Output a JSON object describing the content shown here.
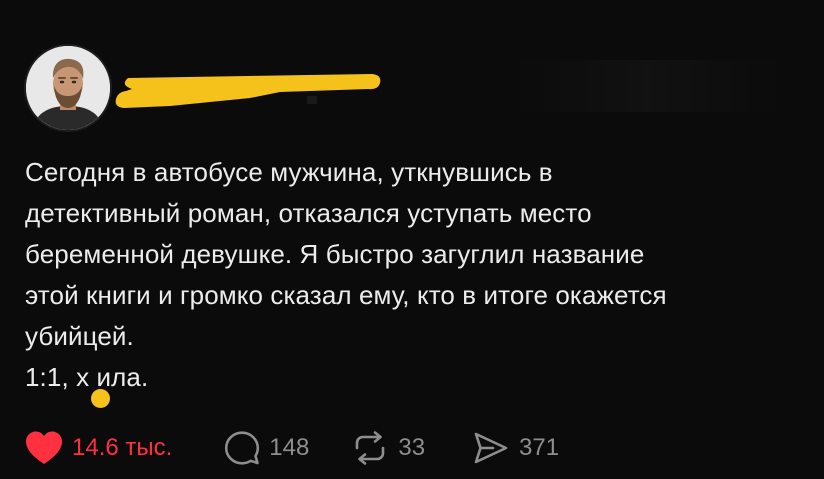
{
  "post": {
    "text_line1": "Сегодня в автобусе мужчина, уткнувшись в",
    "text_line2": "детективный роман, отказался уступать место",
    "text_line3": "беременной девушке. Я быстро загуглил название",
    "text_line4": "этой книги и громко сказал ему, кто в итоге окажется",
    "text_line5": "убийцей.",
    "text_line6": "1:1, х ила."
  },
  "actions": {
    "likes": "14.6 тыс.",
    "comments": "148",
    "reposts": "33",
    "shares": "371"
  },
  "icons": {
    "like": "heart-icon",
    "comment": "comment-bubble-icon",
    "repost": "repost-arrows-icon",
    "share": "send-icon"
  },
  "colors": {
    "background": "#0b0b0b",
    "text": "#ececec",
    "muted": "#8e8e8e",
    "like": "#ff3040",
    "redaction": "#f5c21b"
  }
}
